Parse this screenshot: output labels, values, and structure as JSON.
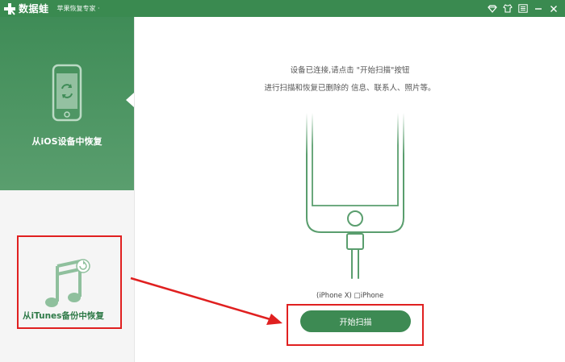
{
  "titlebar": {
    "app_name": "数据蛙",
    "subtitle": "苹果恢复专家 ·",
    "bg_color": "#3a8a50"
  },
  "sidebar": {
    "ios_label": "从iOS设备中恢复",
    "itunes_label": "从iTunes备份中恢复",
    "active_color": "#3f8c57"
  },
  "main": {
    "instruction_line1": "设备已连接,请点击 \"开始扫描\"按钮",
    "instruction_line2": "进行扫描和恢复已删除的 信息、联系人、照片等。",
    "device_name": "(iPhone X) □iPhone",
    "scan_button": "开始扫描"
  },
  "icons": {
    "logo": "plus-logo-icon",
    "titlebar": [
      "diamond-icon",
      "shirt-icon",
      "menu-icon",
      "minimize-icon",
      "close-icon"
    ],
    "ios": "phone-refresh-icon",
    "itunes": "music-note-icon"
  },
  "annotations": {
    "box_color": "#e02020"
  }
}
